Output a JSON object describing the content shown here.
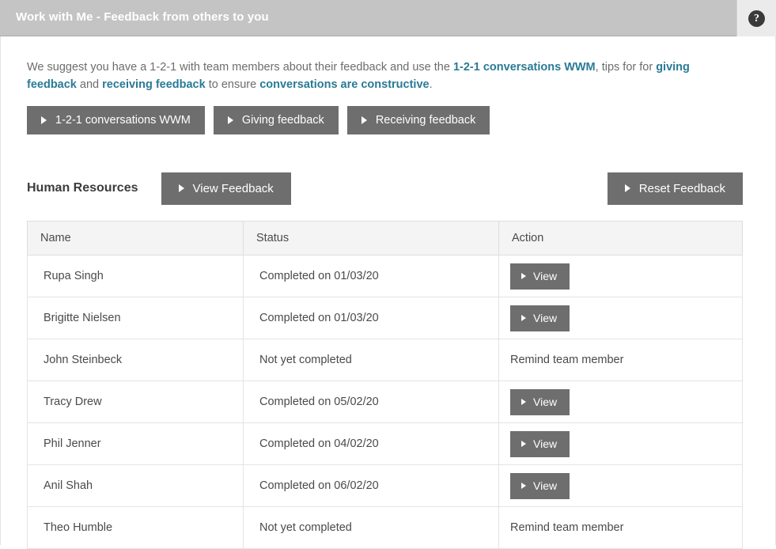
{
  "titlebar": {
    "title": "Work with Me - Feedback from others to you",
    "help_icon_label": "?",
    "bg_color": "#c4c4c4"
  },
  "intro": {
    "seg1": "We suggest you have a 1-2-1 with team members about their feedback and use the ",
    "link1": "1-2-1 conversations WWM",
    "seg2": ", tips for for ",
    "link2": "giving feedback",
    "seg3": " and ",
    "link3": "receiving feedback",
    "seg4": " to ensure ",
    "link4": "conversations are constructive",
    "seg5": ".",
    "link_color": "#2a7a96"
  },
  "link_buttons": [
    {
      "label": "1-2-1 conversations WWM"
    },
    {
      "label": "Giving feedback"
    },
    {
      "label": "Receiving feedback"
    }
  ],
  "section": {
    "title": "Human Resources",
    "view_feedback_label": "View Feedback",
    "reset_feedback_label": "Reset Feedback"
  },
  "table": {
    "headers": [
      "Name",
      "Status",
      "Action"
    ],
    "rows": [
      {
        "name": "Rupa Singh",
        "status": "Completed on 01/03/20",
        "action_label": "View",
        "action_type": "button"
      },
      {
        "name": "Brigitte Nielsen",
        "status": "Completed on 01/03/20",
        "action_label": "View",
        "action_type": "button"
      },
      {
        "name": "John Steinbeck",
        "status": "Not yet completed",
        "action_label": "Remind team member",
        "action_type": "text"
      },
      {
        "name": "Tracy Drew",
        "status": "Completed on 05/02/20",
        "action_label": "View",
        "action_type": "button"
      },
      {
        "name": "Phil Jenner",
        "status": "Completed on 04/02/20",
        "action_label": "View",
        "action_type": "button"
      },
      {
        "name": "Anil Shah",
        "status": "Completed on 06/02/20",
        "action_label": "View",
        "action_type": "button"
      },
      {
        "name": "Theo Humble",
        "status": "Not yet completed",
        "action_label": "Remind team member",
        "action_type": "text"
      }
    ]
  },
  "colors": {
    "button_grey": "#6e6e6e",
    "header_grey": "#c4c4c4",
    "table_header_bg": "#f4f4f4"
  }
}
